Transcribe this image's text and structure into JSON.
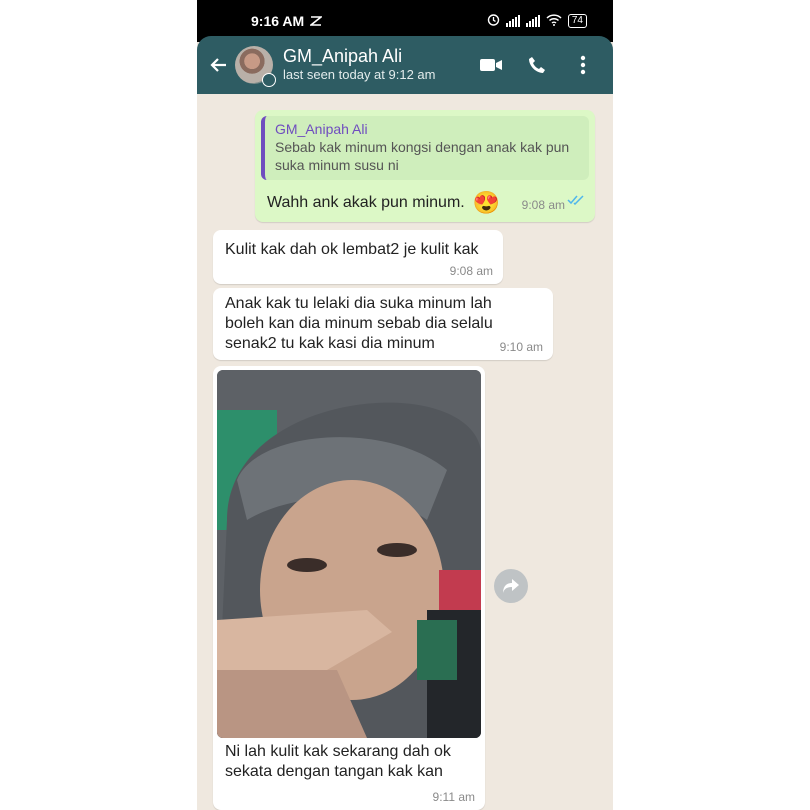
{
  "status_bar": {
    "time": "9:16 AM",
    "battery": "74"
  },
  "header": {
    "contact_name": "GM_Anipah Ali",
    "last_seen": "last seen today at 9:12 am"
  },
  "messages": [
    {
      "direction": "outgoing",
      "quote_author": "GM_Anipah Ali",
      "quote_text": "Sebab kak minum kongsi dengan anak kak pun suka minum susu ni",
      "text": "Wahh ank akak pun minum.",
      "emoji": "😍",
      "time": "9:08 am",
      "status": "read"
    },
    {
      "direction": "incoming",
      "text": "Kulit kak dah ok lembat2 je kulit kak",
      "time": "9:08 am"
    },
    {
      "direction": "incoming",
      "text": "Anak kak tu lelaki dia suka minum lah boleh kan dia minum sebab dia selalu senak2 tu kak kasi dia minum",
      "time": "9:10 am"
    },
    {
      "direction": "incoming",
      "type": "image",
      "caption": "Ni lah kulit kak sekarang dah ok sekata dengan tangan kak kan",
      "time": "9:11 am"
    }
  ],
  "icons": {
    "back": "arrow-left-icon",
    "video": "video-call-icon",
    "call": "phone-icon",
    "menu": "more-vertical-icon",
    "share": "forward-icon"
  },
  "colors": {
    "header": "#2e5c63",
    "outgoing_bubble": "#dcf8c6",
    "incoming_bubble": "#ffffff",
    "read_tick": "#4fb6ec",
    "quote_accent": "#6f4dbf"
  }
}
